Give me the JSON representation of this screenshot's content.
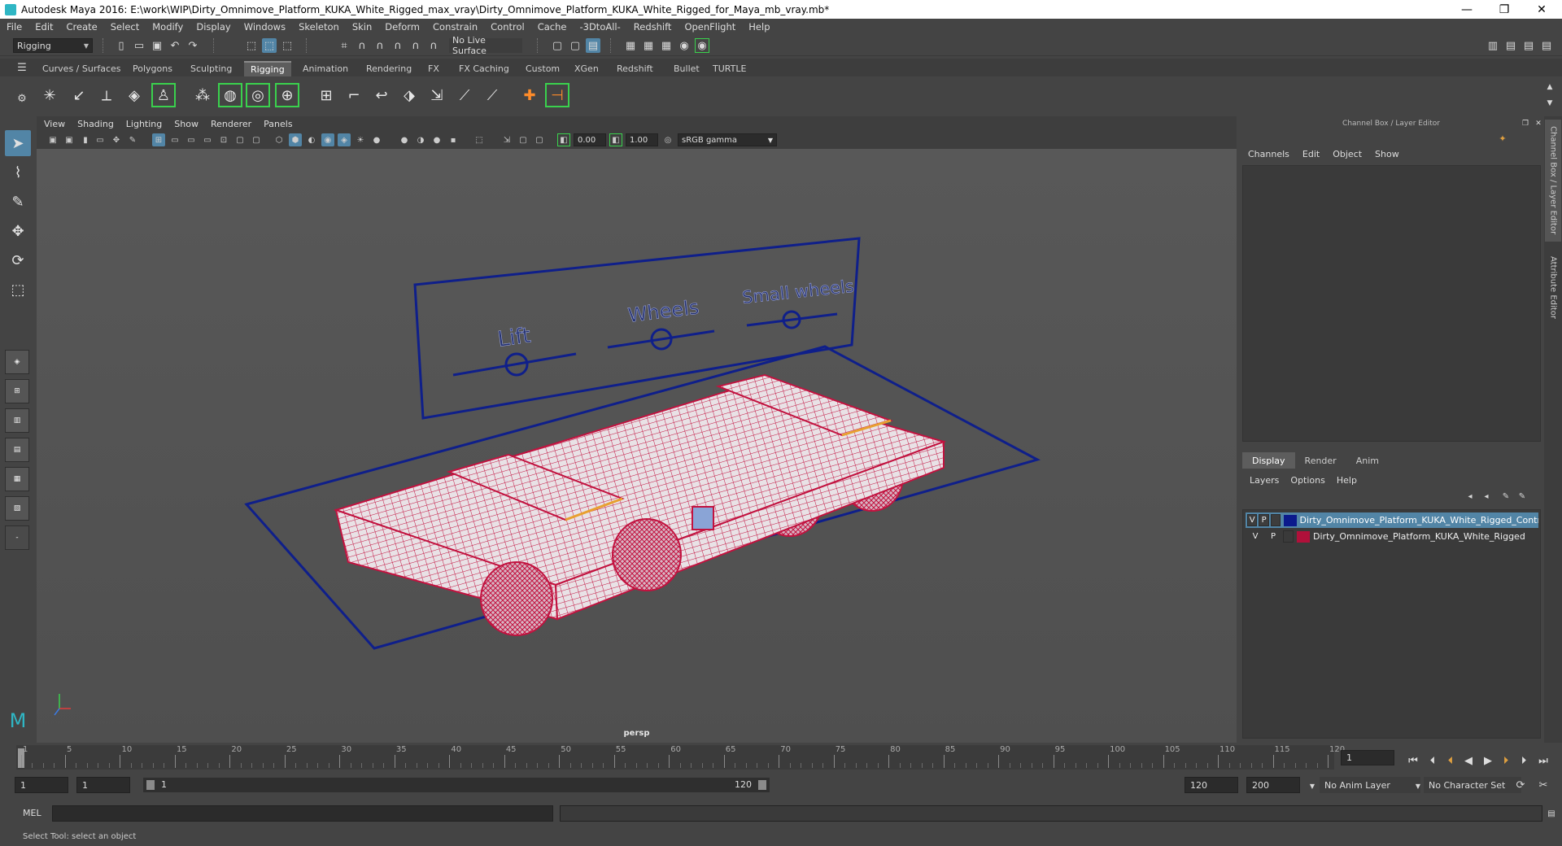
{
  "window": {
    "title": "Autodesk Maya 2016: E:\\work\\WIP\\Dirty_Omnimove_Platform_KUKA_White_Rigged_max_vray\\Dirty_Omnimove_Platform_KUKA_White_Rigged_for_Maya_mb_vray.mb*",
    "minimize": "—",
    "restore": "❐",
    "close": "✕"
  },
  "menubar": [
    "File",
    "Edit",
    "Create",
    "Select",
    "Modify",
    "Display",
    "Windows",
    "Skeleton",
    "Skin",
    "Deform",
    "Constrain",
    "Control",
    "Cache",
    "-3DtoAll-",
    "Redshift",
    "OpenFlight",
    "Help"
  ],
  "statusline": {
    "mode": "Rigging",
    "live_surface": "No Live Surface"
  },
  "shelf_tabs": [
    "Curves / Surfaces",
    "Polygons",
    "Sculpting",
    "Rigging",
    "Animation",
    "Rendering",
    "FX",
    "FX Caching",
    "Custom",
    "XGen",
    "Redshift",
    "Bullet",
    "TURTLE"
  ],
  "shelf_active": "Rigging",
  "viewport": {
    "menu": [
      "View",
      "Shading",
      "Lighting",
      "Show",
      "Renderer",
      "Panels"
    ],
    "exposure": "0.00",
    "gamma": "1.00",
    "color_space": "sRGB gamma",
    "camera_label": "persp",
    "control_labels": [
      "Lift",
      "Wheels",
      "Small wheels"
    ],
    "colors": {
      "wire": "#c2123f",
      "control": "#0f1f8a",
      "background": "#555555"
    }
  },
  "channel_box": {
    "title": "Channel Box / Layer Editor",
    "menu": [
      "Channels",
      "Edit",
      "Object",
      "Show"
    ]
  },
  "layer_editor": {
    "tabs": [
      "Display",
      "Render",
      "Anim"
    ],
    "active_tab": "Display",
    "menu": [
      "Layers",
      "Options",
      "Help"
    ],
    "layers": [
      {
        "v": "V",
        "p": "P",
        "name": "Dirty_Omnimove_Platform_KUKA_White_Rigged_Controll",
        "color": "#0b1a8c",
        "selected": true
      },
      {
        "v": "V",
        "p": "P",
        "name": "Dirty_Omnimove_Platform_KUKA_White_Rigged",
        "color": "#b0103a",
        "selected": false
      }
    ]
  },
  "side_tabs": [
    "Channel Box / Layer Editor",
    "Attribute Editor"
  ],
  "timeline": {
    "tick_labels": [
      "1",
      "5",
      "10",
      "15",
      "20",
      "25",
      "30",
      "35",
      "40",
      "45",
      "50",
      "55",
      "60",
      "65",
      "70",
      "75",
      "80",
      "85",
      "90",
      "95",
      "100",
      "105",
      "110",
      "115",
      "120"
    ],
    "current_frame": "1"
  },
  "range": {
    "start": "1",
    "playback_start": "1",
    "slider_start": "1",
    "slider_end": "120",
    "playback_end": "120",
    "end": "200",
    "anim_layer": "No Anim Layer",
    "character_set": "No Character Set"
  },
  "command_line": {
    "label": "MEL"
  },
  "help_line": "Select Tool: select an object"
}
